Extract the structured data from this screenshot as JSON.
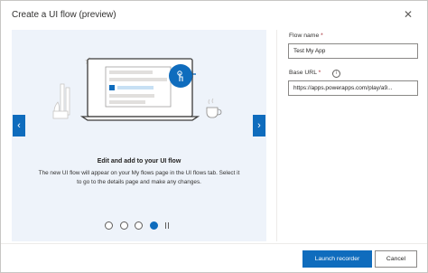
{
  "dialog": {
    "title": "Create a UI flow (preview)",
    "close_glyph": "✕"
  },
  "carousel": {
    "prev_glyph": "‹",
    "next_glyph": "›",
    "heading": "Edit and add to your UI flow",
    "description": "The new UI flow will appear on your My flows page in the UI flows tab. Select it to go to the details page and make any changes.",
    "slide_count": 4,
    "active_slide": 4,
    "accent_color": "#0f6cbd"
  },
  "form": {
    "flow_name_label": "Flow name",
    "flow_name_value": "Test My App",
    "base_url_label": "Base URL",
    "base_url_value": "https://apps.powerapps.com/play/a9...",
    "required_marker": "*",
    "info_glyph": "i"
  },
  "footer": {
    "launch_label": "Launch recorder",
    "cancel_label": "Cancel"
  }
}
